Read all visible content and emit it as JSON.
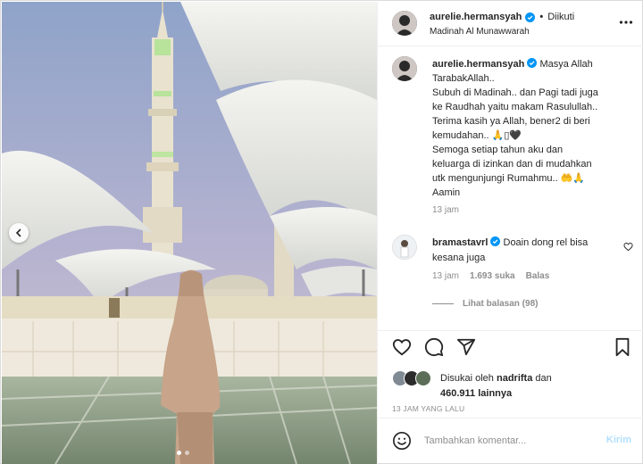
{
  "header": {
    "username": "aurelie.hermansyah",
    "separator": "•",
    "follow_label": "Diikuti",
    "location": "Madinah Al Munawwarah",
    "icons": {
      "verified": "verified-badge-icon",
      "more": "more-options-icon"
    }
  },
  "caption": {
    "username": "aurelie.hermansyah",
    "lines": [
      "Masya Allah",
      "TarabakAllah..",
      "Subuh di Madinah.. dan Pagi tadi juga",
      "ke Raudhah yaitu makam Rasulullah..",
      "Terima kasih ya Allah, bener2 di beri",
      "kemudahan.. 🙏▯🖤",
      "Semoga setiap tahun aku dan",
      "keluarga di izinkan dan di mudahkan",
      "utk mengunjungi Rumahmu.. 🤲🙏",
      "Aamin"
    ],
    "time": "13 jam"
  },
  "comment": {
    "username": "bramastavrl",
    "lines": [
      "Doain dong rel bisa",
      "kesana juga"
    ],
    "time": "13 jam",
    "likes": "1.693 suka",
    "reply_label": "Balas",
    "view_replies": "Lihat balasan (98)"
  },
  "actions": {
    "icons": [
      "heart-icon",
      "comment-icon",
      "share-icon",
      "bookmark-icon"
    ]
  },
  "likes": {
    "prefix": "Disukai oleh",
    "first_liker": "nadrifta",
    "joiner": "dan",
    "others": "460.911 lainnya"
  },
  "post_date": "13 JAM YANG LALU",
  "add_comment": {
    "placeholder": "Tambahkan komentar...",
    "send_label": "Kirim"
  },
  "carousel": {
    "dots": 2,
    "active_index": 0
  },
  "colors": {
    "verified": "#0095f6",
    "send_disabled": "#b2dffc",
    "muted": "#8e8e8e"
  }
}
